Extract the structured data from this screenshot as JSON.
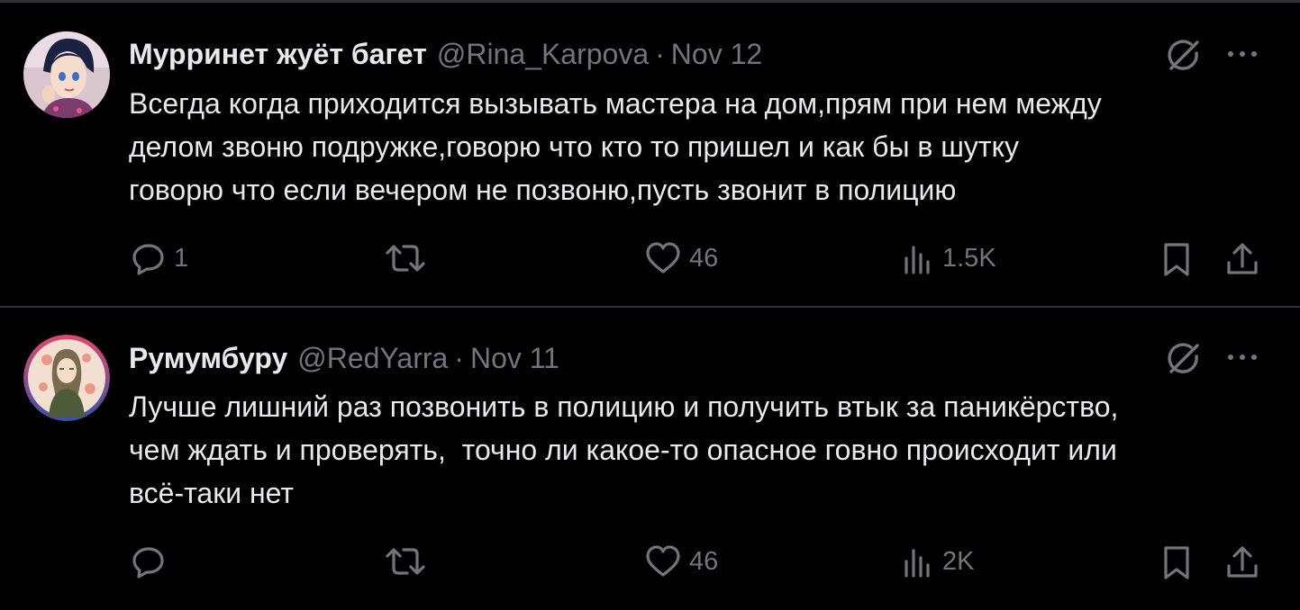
{
  "tweets": [
    {
      "display_name": "Мурринет жуёт багет",
      "handle": "@Rina_Karpova",
      "separator": "·",
      "date": "Nov 12",
      "text_lines": [
        "Всегда когда приходится вызывать мастера на дом,прям при нем между",
        "делом звоню подружке,говорю что кто то пришел и как бы в шутку",
        "говорю что если вечером не позвоню,пусть звонит в полицию"
      ],
      "actions": {
        "replies": "1",
        "retweets": "",
        "likes": "46",
        "views": "1.5K"
      }
    },
    {
      "display_name": "Румумбуру",
      "handle": "@RedYarra",
      "separator": "·",
      "date": "Nov 11",
      "text_lines": [
        "Лучше лишний раз позвонить в полицию и получить втык за паникёрство,",
        "чем ждать и проверять,  точно ли какое-то опасное говно происходит или",
        "всё-таки нет"
      ],
      "actions": {
        "replies": "",
        "retweets": "",
        "likes": "46",
        "views": "2K"
      }
    }
  ],
  "icons": [
    "reply-icon",
    "retweet-icon",
    "like-icon",
    "views-icon",
    "bookmark-icon",
    "share-icon",
    "grok-icon",
    "more-icon"
  ],
  "colors": {
    "background": "#000000",
    "text": "#e7e9ea",
    "muted": "#71767b",
    "divider": "#2f3336"
  }
}
